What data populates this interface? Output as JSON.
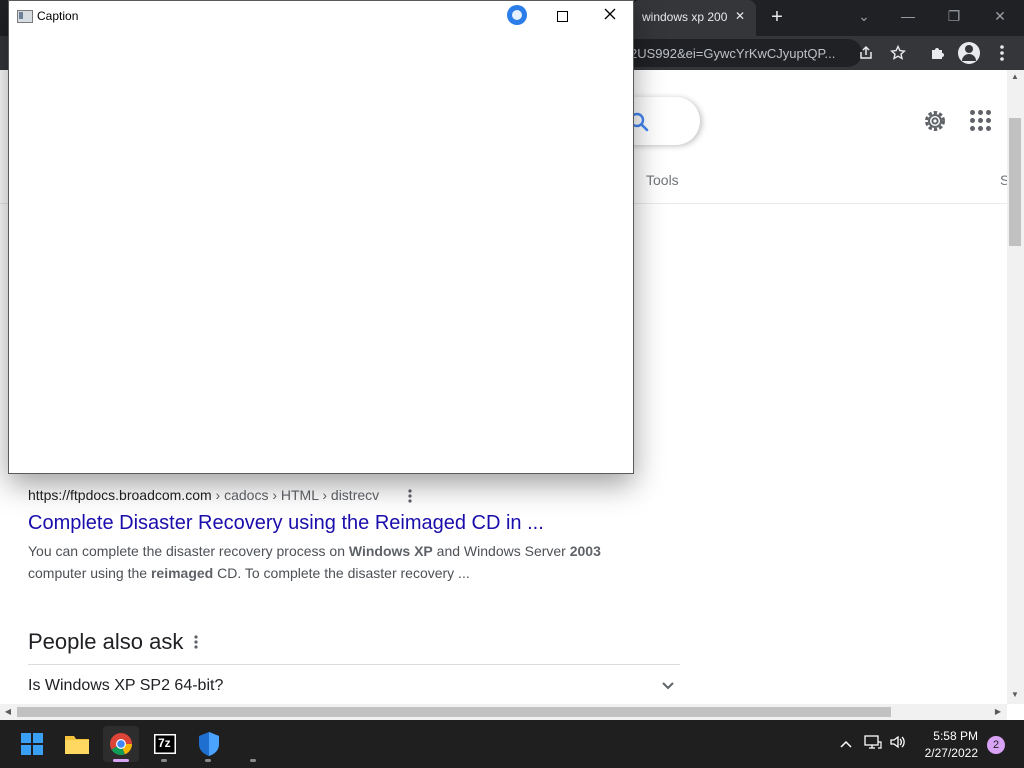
{
  "browser": {
    "tab_title": "windows xp 200",
    "tab_close": "✕",
    "new_tab": "+",
    "address_text": "2US992&ei=GywcYrKwCJyuptQP...",
    "window_controls": {
      "search_tabs": "⌄",
      "minimize": "—",
      "restore": "❐",
      "close": "✕"
    },
    "toolbar_icons": {
      "share": "share-icon",
      "bookmark": "star-icon",
      "extensions": "puzzle-icon",
      "profile": "avatar-icon",
      "menu": "kebab-menu-icon"
    }
  },
  "search_page": {
    "tools_label": "Tools",
    "cut_tab_label": "S",
    "result": {
      "cite_host": "https://ftpdocs.broadcom.com",
      "cite_path": " › cadocs › HTML › distrecv",
      "title": "Complete Disaster Recovery using the Reimaged CD in ...",
      "snippet_parts": [
        "You can complete the disaster recovery process on ",
        "Windows XP",
        " and Windows Server ",
        "2003",
        " computer using the ",
        "reimaged",
        " CD. To complete the disaster recovery ..."
      ]
    },
    "people_also_ask": {
      "heading": "People also ask",
      "question": "Is Windows XP SP2 64-bit?"
    }
  },
  "dialog": {
    "title": "Caption"
  },
  "taskbar": {
    "apps": [
      "start-icon",
      "file-explorer-icon",
      "chrome-icon",
      "7zip-icon",
      "windows-security-icon"
    ],
    "sevenzip_label": "7z",
    "time": "5:58 PM",
    "date": "2/27/2022",
    "notification_count": "2"
  },
  "colors": {
    "link": "#1a0dab",
    "accent_blue": "#4285f4",
    "chrome_dark": "#202124",
    "taskbar": "#1f1f1f"
  }
}
